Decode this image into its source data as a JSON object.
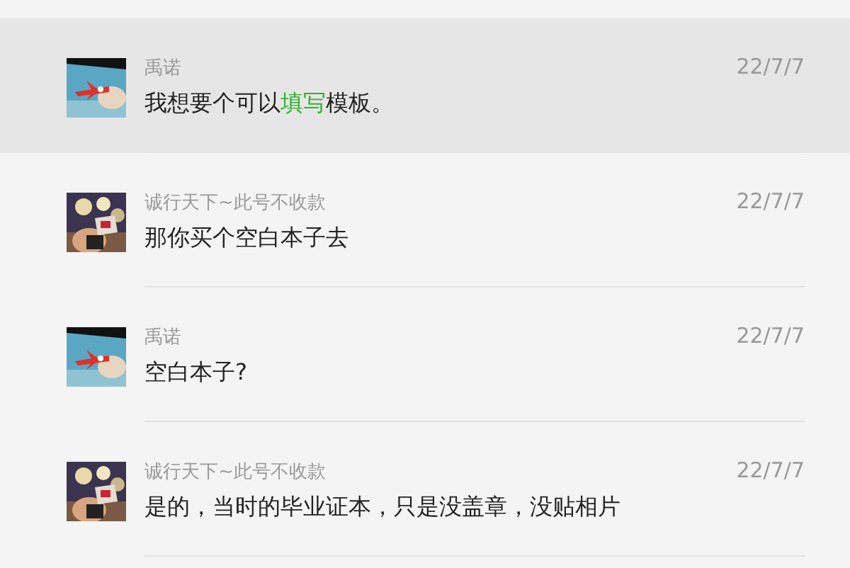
{
  "comments": [
    {
      "author": "禹诺",
      "date": "22/7/7",
      "selected": true,
      "avatar": {
        "kind": "picture"
      },
      "message": [
        {
          "text": "我想要个可以"
        },
        {
          "text": "填写",
          "kind": "link"
        },
        {
          "text": "模板。"
        }
      ]
    },
    {
      "author": "诚行天下~此号不收款",
      "date": "22/7/7",
      "selected": false,
      "avatar": {
        "kind": "picture"
      },
      "message": [
        {
          "text": "那你买个空白本子去"
        }
      ]
    },
    {
      "author": "禹诺",
      "date": "22/7/7",
      "selected": false,
      "avatar": {
        "kind": "picture"
      },
      "message": [
        {
          "text": "空白本子?"
        }
      ]
    },
    {
      "author": "诚行天下~此号不收款",
      "date": "22/7/7",
      "selected": false,
      "avatar": {
        "kind": "picture"
      },
      "message": [
        {
          "text": "是的，当时的毕业证本，只是没盖章，没贴相片"
        }
      ]
    }
  ]
}
